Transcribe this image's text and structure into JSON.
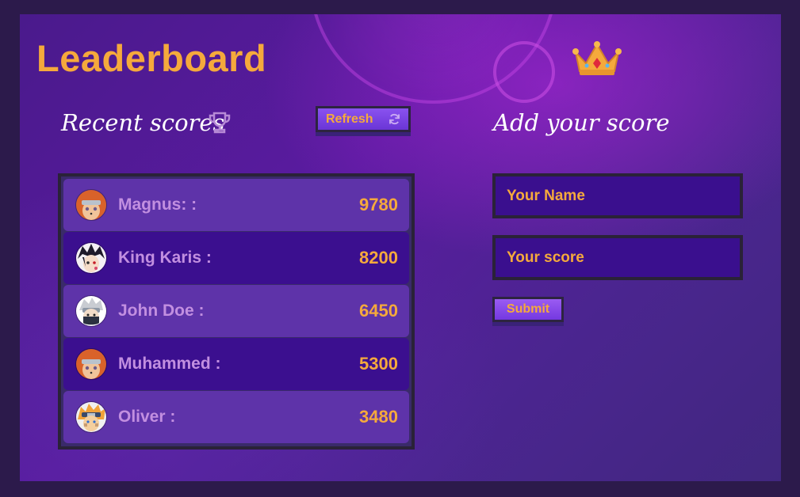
{
  "header": {
    "title": "Leaderboard"
  },
  "recent": {
    "heading": "Recent scores",
    "refresh_label": "Refresh"
  },
  "players": [
    {
      "name": "Magnus: :",
      "score": "9780",
      "avatar": "pain-avatar"
    },
    {
      "name": "King Karis :",
      "score": "8200",
      "avatar": "sasuke-avatar"
    },
    {
      "name": "John Doe :",
      "score": "6450",
      "avatar": "kakashi-avatar"
    },
    {
      "name": "Muhammed :",
      "score": "5300",
      "avatar": "pain-avatar"
    },
    {
      "name": "Oliver :",
      "score": "3480",
      "avatar": "naruto-avatar"
    }
  ],
  "form": {
    "heading": "Add your score",
    "name_placeholder": "Your Name",
    "score_placeholder": "Your score",
    "submit_label": "Submit"
  },
  "colors": {
    "accent": "#f5a93c",
    "name_text": "#c28fe0",
    "row_dark": "#3b0f8f",
    "button": "#7438e0"
  },
  "icons": [
    "crown-icon",
    "trophy-icon",
    "refresh-icon"
  ]
}
